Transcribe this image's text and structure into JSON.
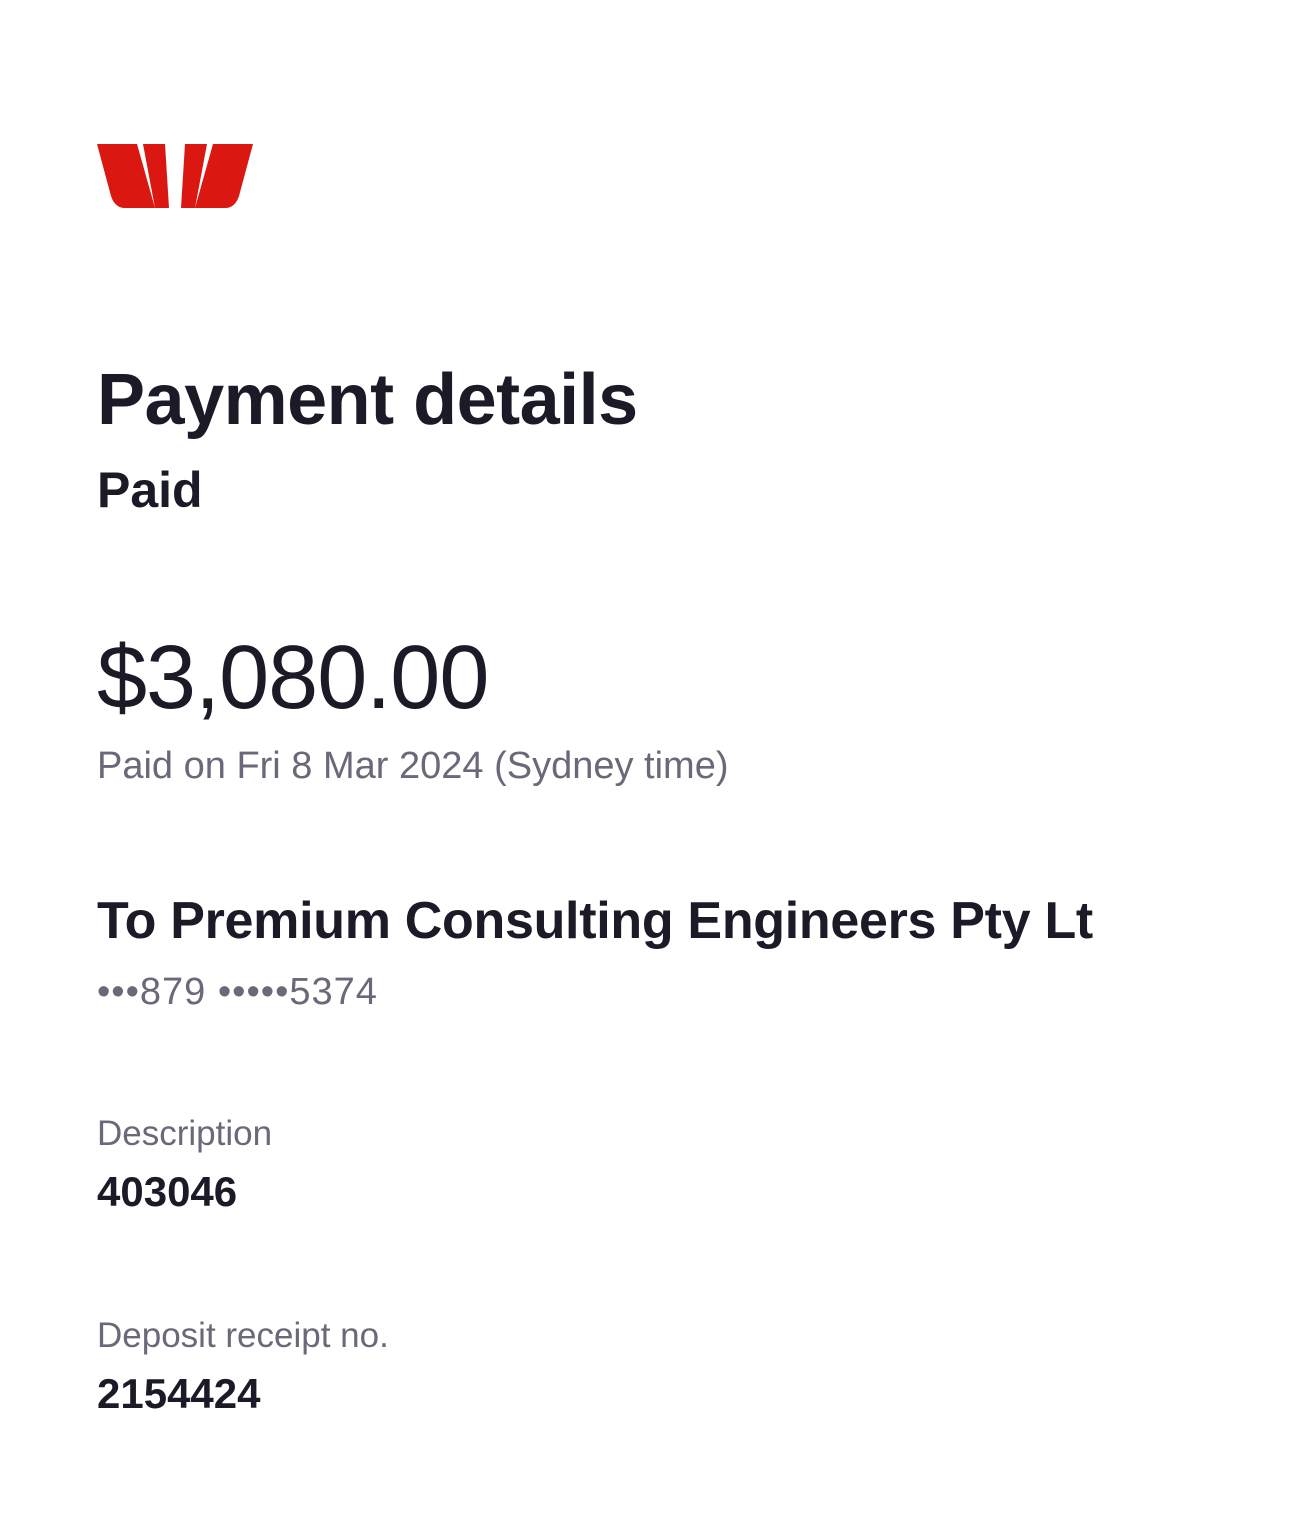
{
  "brand": {
    "logo_icon": "westpac-logo-icon",
    "color": "#da1710"
  },
  "header": {
    "title": "Payment details",
    "status": "Paid"
  },
  "payment": {
    "amount": "$3,080.00",
    "paid_on": "Paid on Fri 8 Mar 2024 (Sydney time)"
  },
  "payee": {
    "name": "To Premium Consulting Engineers Pty Lt",
    "account": "•••879 •••••5374"
  },
  "details": {
    "description_label": "Description",
    "description_value": "403046",
    "receipt_label": "Deposit receipt no.",
    "receipt_value": "2154424"
  }
}
